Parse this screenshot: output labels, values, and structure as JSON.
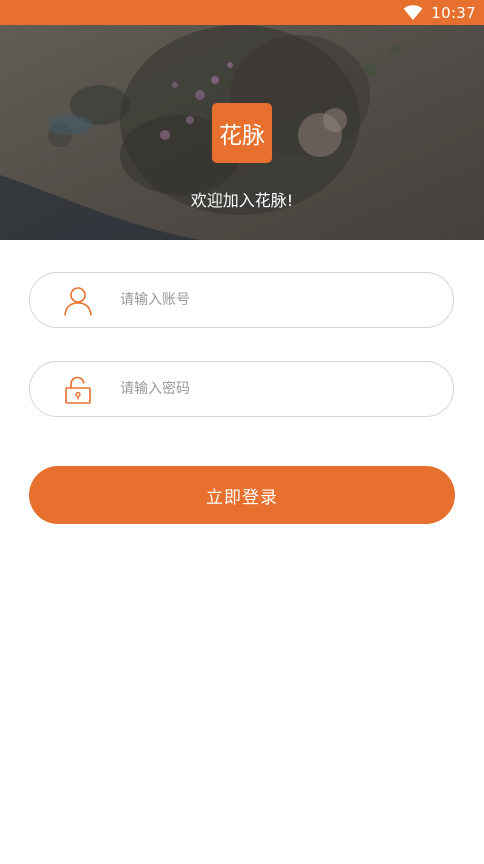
{
  "status_bar": {
    "time": "10:37",
    "wifi_icon": "wifi-icon"
  },
  "banner": {
    "logo_text": "花脉",
    "welcome_text": "欢迎加入花脉!"
  },
  "login_form": {
    "account": {
      "placeholder": "请输入账号",
      "value": "",
      "icon": "user-icon"
    },
    "password": {
      "placeholder": "请输入密码",
      "value": "",
      "icon": "lock-icon"
    },
    "submit_label": "立即登录"
  },
  "colors": {
    "accent": "#e8702e",
    "field_border": "#d6d6d6",
    "placeholder": "#9a9a9a",
    "background": "#ffffff"
  }
}
